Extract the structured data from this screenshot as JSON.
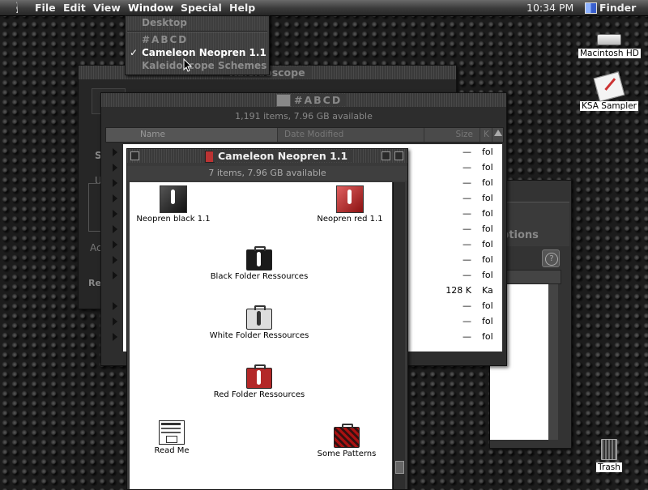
{
  "menubar": {
    "menus": [
      "File",
      "Edit",
      "View",
      "Window",
      "Special",
      "Help"
    ],
    "clock": "10:34 PM",
    "app": "Finder"
  },
  "window_menu": {
    "items": [
      "Desktop",
      "#ABCD",
      "Cameleon Neopren 1.1",
      "Kaleidoscope Schemes"
    ],
    "checked": "Cameleon Neopren 1.1",
    "check_mark": "✓"
  },
  "windows": {
    "kaleidoscope": {
      "title": "Kaleidoscope",
      "label_s": "S",
      "label_u": "U",
      "label_a": "Ac",
      "label_re": "Re"
    },
    "options": {
      "label": "ptions",
      "help": "?"
    },
    "abcd": {
      "title": "#ABCD",
      "info": "1,191 items, 7.96 GB available",
      "columns": {
        "name": "Name",
        "date": "Date Modified",
        "size": "Size",
        "kind": "K"
      },
      "rows": [
        {
          "size": "—",
          "kind": "fol"
        },
        {
          "size": "—",
          "kind": "fol"
        },
        {
          "size": "—",
          "kind": "fol"
        },
        {
          "size": "—",
          "kind": "fol"
        },
        {
          "size": "—",
          "kind": "fol"
        },
        {
          "size": "—",
          "kind": "fol"
        },
        {
          "size": "—",
          "kind": "fol"
        },
        {
          "size": "—",
          "kind": "fol"
        },
        {
          "size": "—",
          "kind": "fol"
        },
        {
          "size": "128 K",
          "kind": "Ka"
        },
        {
          "size": "—",
          "kind": "fol"
        },
        {
          "size": "—",
          "kind": "fol"
        },
        {
          "size": "—",
          "kind": "fol"
        }
      ]
    },
    "cameleon": {
      "title": "Cameleon Neopren 1.1",
      "info": "7 items, 7.96 GB available",
      "items": [
        {
          "label": "Neopren black 1.1",
          "icon": "app-icon-black"
        },
        {
          "label": "Neopren red 1.1",
          "icon": "app-icon-red"
        },
        {
          "label": "Black Folder Ressources",
          "icon": "suitcase-black"
        },
        {
          "label": "White Folder Ressources",
          "icon": "suitcase-white"
        },
        {
          "label": "Red Folder Ressources",
          "icon": "suitcase-red"
        },
        {
          "label": "Read Me",
          "icon": "document-icon"
        },
        {
          "label": "Some Patterns",
          "icon": "suitcase-pattern"
        }
      ]
    }
  },
  "desktop": {
    "icons": [
      "Macintosh HD",
      "KSA Sampler",
      "Trash"
    ]
  }
}
